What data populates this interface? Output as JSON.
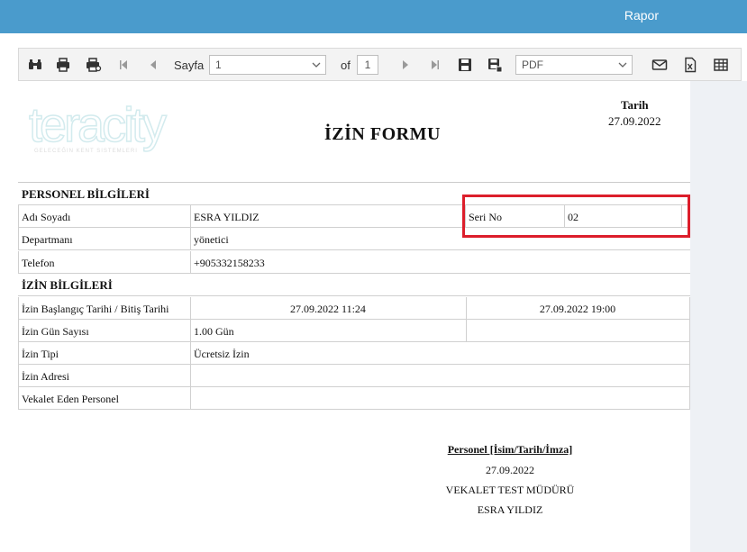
{
  "app": {
    "title": "Rapor"
  },
  "toolbar": {
    "page_label": "Sayfa",
    "page_value": "1",
    "of_label": "of",
    "page_total": "1",
    "export_format": "PDF",
    "icons": [
      "binoculars-icon",
      "print-icon",
      "print-preview-icon",
      "first-page-icon",
      "prev-page-icon",
      "next-page-icon",
      "last-page-icon",
      "save-icon",
      "save-as-icon",
      "email-icon",
      "excel-icon",
      "grid-icon"
    ]
  },
  "report": {
    "title": "İZİN FORMU",
    "date_label": "Tarih",
    "date_value": "27.09.2022",
    "personnel_section": "PERSONEL BİLGİLERİ",
    "name_label": "Adı Soyadı",
    "name_value": "ESRA YILDIZ",
    "serial_label": "Seri No",
    "serial_value": "02",
    "department_label": "Departmanı",
    "department_value": "yönetici",
    "phone_label": "Telefon",
    "phone_value": "+905332158233",
    "leave_section": "İZİN BİLGİLERİ",
    "start_end_label": "İzin Başlangıç Tarihi / Bitiş Tarihi",
    "start_value": "27.09.2022 11:24",
    "end_value": "27.09.2022 19:00",
    "days_label": "İzin Gün Sayısı",
    "days_value": "1.00 Gün",
    "type_label": "İzin Tipi",
    "type_value": "Ücretsiz İzin",
    "address_label": "İzin Adresi",
    "address_value": "",
    "proxy_label": "Vekalet Eden Personel",
    "proxy_value": "",
    "signature": {
      "title": "Personel [İsim/Tarih/İmza]",
      "date": "27.09.2022",
      "role": "VEKALET TEST MÜDÜRÜ",
      "name": "ESRA YILDIZ"
    }
  },
  "logo": {
    "word": "teracity",
    "tagline": "GELECEĞIN KENT SISTEMLERI"
  },
  "colors": {
    "header": "#4a9bcc",
    "highlight": "#dc1e2b",
    "logo": "#d3ebee"
  }
}
